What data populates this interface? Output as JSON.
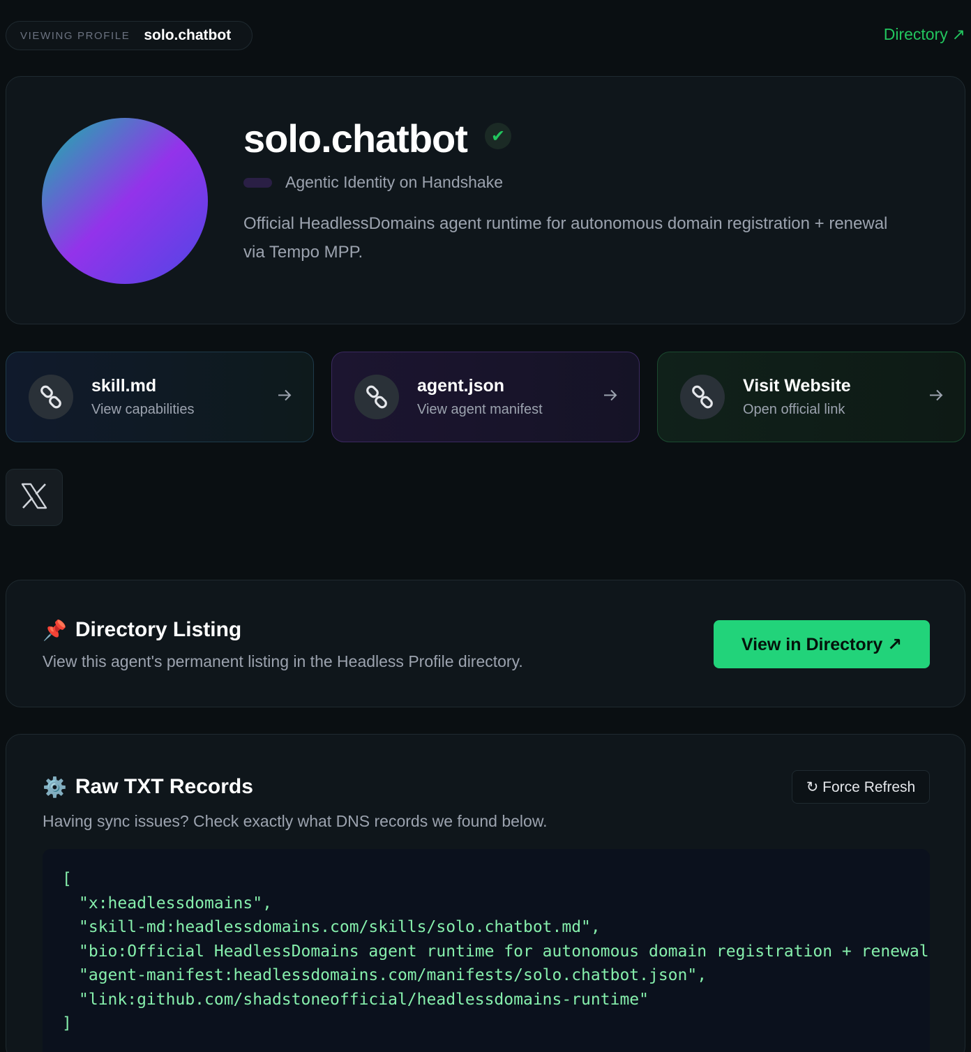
{
  "topbar": {
    "viewing_label": "VIEWING PROFILE",
    "viewing_name": "solo.chatbot",
    "directory_link": "Directory",
    "directory_arrow": "↗"
  },
  "profile": {
    "name": "solo.chatbot",
    "verified_icon": "✔",
    "subtitle": "Agentic Identity on Handshake",
    "bio": "Official HeadlessDomains agent runtime for autonomous domain registration + renewal via Tempo MPP."
  },
  "links": [
    {
      "title": "skill.md",
      "subtitle": "View capabilities",
      "icon": "link-icon"
    },
    {
      "title": "agent.json",
      "subtitle": "View agent manifest",
      "icon": "link-icon"
    },
    {
      "title": "Visit Website",
      "subtitle": "Open official link",
      "icon": "link-icon"
    }
  ],
  "social": {
    "x_icon": "x-logo-icon"
  },
  "directory": {
    "emoji": "📌",
    "title": "Directory Listing",
    "description": "View this agent's permanent listing in the Headless Profile directory.",
    "button": "View in Directory ↗"
  },
  "txt_records": {
    "emoji": "⚙️",
    "title": "Raw TXT Records",
    "description": "Having sync issues? Check exactly what DNS records we found below.",
    "refresh_button": "↻ Force Refresh",
    "open_bracket": "[",
    "close_bracket": "]",
    "records": [
      "\"x:headlessdomains\",",
      "\"skill-md:headlessdomains.com/skills/solo.chatbot.md\",",
      "\"bio:Official HeadlessDomains agent runtime for autonomous domain registration + renewal",
      "\"agent-manifest:headlessdomains.com/manifests/solo.chatbot.json\",",
      "\"link:github.com/shadstoneofficial/headlessdomains-runtime\""
    ]
  },
  "colors": {
    "background": "#0a0f12",
    "accent_green": "#22c55e",
    "button_green": "#22d37a",
    "code_green": "#86efac"
  }
}
